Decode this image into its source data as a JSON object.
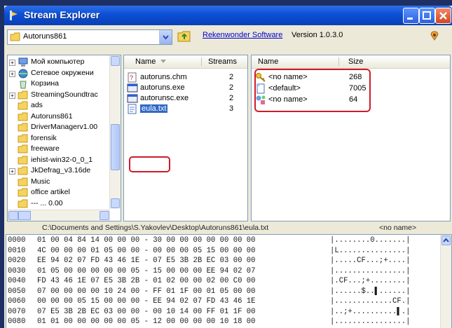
{
  "window": {
    "title": "Stream Explorer",
    "title_color": "#0b4fd6",
    "accent_red": "#d11a2a"
  },
  "toolbar": {
    "folder_combo_value": "Autoruns861",
    "link_text": "Rekenwonder Software",
    "version": "Version 1.0.3.0"
  },
  "tree": {
    "items": [
      {
        "label": "Мой компьютер",
        "icon": "computer-icon",
        "expand": "+"
      },
      {
        "label": "Сетевое окружени",
        "icon": "network-icon",
        "expand": "+"
      },
      {
        "label": "Корзина",
        "icon": "recycle-bin-icon",
        "expand": ""
      },
      {
        "label": "StreamingSoundtrac",
        "icon": "folder-icon",
        "expand": "+"
      },
      {
        "label": "ads",
        "icon": "folder-icon",
        "expand": ""
      },
      {
        "label": "Autoruns861",
        "icon": "folder-icon",
        "expand": ""
      },
      {
        "label": "DriverManagerv1.00",
        "icon": "folder-icon",
        "expand": ""
      },
      {
        "label": "forensik",
        "icon": "folder-icon",
        "expand": ""
      },
      {
        "label": "freeware",
        "icon": "folder-icon",
        "expand": ""
      },
      {
        "label": "iehist-win32-0_0_1",
        "icon": "folder-icon",
        "expand": ""
      },
      {
        "label": "JkDefrag_v3.16de",
        "icon": "folder-icon",
        "expand": "+"
      },
      {
        "label": "Music",
        "icon": "folder-icon",
        "expand": ""
      },
      {
        "label": "office artikel",
        "icon": "folder-icon",
        "expand": ""
      },
      {
        "label": "--- ... 0.00",
        "icon": "folder-icon",
        "expand": ""
      }
    ]
  },
  "files": {
    "columns": {
      "name": "Name",
      "streams": "Streams"
    },
    "rows": [
      {
        "name": "autoruns.chm",
        "streams": "2",
        "icon": "help-file-icon"
      },
      {
        "name": "autoruns.exe",
        "streams": "2",
        "icon": "exe-icon"
      },
      {
        "name": "autorunsc.exe",
        "streams": "2",
        "icon": "exe-icon"
      },
      {
        "name": "eula.txt",
        "streams": "3",
        "icon": "text-file-icon"
      }
    ]
  },
  "streams": {
    "columns": {
      "name": "Name",
      "size": "Size"
    },
    "rows": [
      {
        "name": "<no name>",
        "size": "268",
        "icon": "key-icon"
      },
      {
        "name": "<default>",
        "size": "7005",
        "icon": "file-icon"
      },
      {
        "name": "<no name>",
        "size": "64",
        "icon": "shapes-icon"
      }
    ]
  },
  "status": {
    "path": "C:\\Documents and Settings\\S.Yakovlev\\Desktop\\Autoruns861\\eula.txt",
    "stream": "<no name>"
  },
  "hex": {
    "rows": [
      {
        "offset": "0000",
        "bytes": "01 00 04 84 14 00 00 00 - 30 00 00 00 00 00 00 00",
        "ascii": "|........0.......|"
      },
      {
        "offset": "0010",
        "bytes": "4C 00 00 00 01 05 00 00 - 00 00 00 05 15 00 00 00",
        "ascii": "|L...............|"
      },
      {
        "offset": "0020",
        "bytes": "EE 94 02 07 FD 43 46 1E - 07 E5 3B 2B EC 03 00 00",
        "ascii": "|.....CF...;+....|"
      },
      {
        "offset": "0030",
        "bytes": "01 05 00 00 00 00 00 05 - 15 00 00 00 EE 94 02 07",
        "ascii": "|................|"
      },
      {
        "offset": "0040",
        "bytes": "FD 43 46 1E 07 E5 3B 2B - 01 02 00 00 02 00 C0 00",
        "ascii": "|.CF...;+........|"
      },
      {
        "offset": "0050",
        "bytes": "07 00 00 00 00 10 24 00 - FF 01 1F 00 01 05 00 00",
        "ascii": "|......$..▌......|"
      },
      {
        "offset": "0060",
        "bytes": "00 00 00 05 15 00 00 00 - EE 94 02 07 FD 43 46 1E",
        "ascii": "|.............CF.|"
      },
      {
        "offset": "0070",
        "bytes": "07 E5 3B 2B EC 03 00 00 - 00 10 14 00 FF 01 1F 00",
        "ascii": "|..;+..........▌.|"
      },
      {
        "offset": "0080",
        "bytes": "01 01 00 00 00 00 00 05 - 12 00 00 00 00 10 18 00",
        "ascii": "|................|"
      }
    ]
  }
}
